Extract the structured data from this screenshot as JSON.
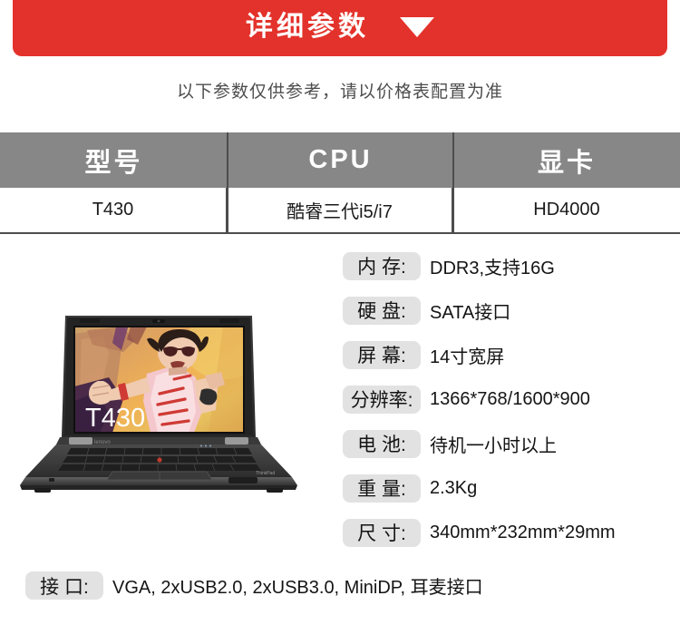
{
  "banner": {
    "title": "详细参数",
    "caret_icon": "triangle-down-icon",
    "background_color": "#e3322b",
    "text_color": "#ffffff"
  },
  "subtitle": {
    "text": "以下参数仅供参考，请以价格表配置为准",
    "color": "#4d4d4d"
  },
  "spec_table": {
    "header_background": "#878787",
    "header_text_color": "#ffffff",
    "columns": [
      "型号",
      "CPU",
      "显卡"
    ],
    "row": [
      "T430",
      "酷睿三代i5/i7",
      "HD4000"
    ]
  },
  "product_image": {
    "alt": "ThinkPad T430 laptop",
    "screen_label": "T430",
    "wallpaper_description": "orange and pink fighting-game artwork"
  },
  "specs": {
    "chip_background": "#e2e2e2",
    "items": [
      {
        "label": "内 存:",
        "value": "DDR3,支持16G"
      },
      {
        "label": "硬 盘:",
        "value": "SATA接口"
      },
      {
        "label": "屏 幕:",
        "value": "14寸宽屏"
      },
      {
        "label": "分辨率:",
        "value": "1366*768/1600*900"
      },
      {
        "label": "电 池:",
        "value": "待机一小时以上"
      },
      {
        "label": "重 量:",
        "value": "2.3Kg"
      },
      {
        "label": "尺 寸:",
        "value": "340mm*232mm*29mm"
      }
    ]
  },
  "interface": {
    "label": "接 口:",
    "value": "VGA, 2xUSB2.0, 2xUSB3.0, MiniDP, 耳麦接口"
  }
}
